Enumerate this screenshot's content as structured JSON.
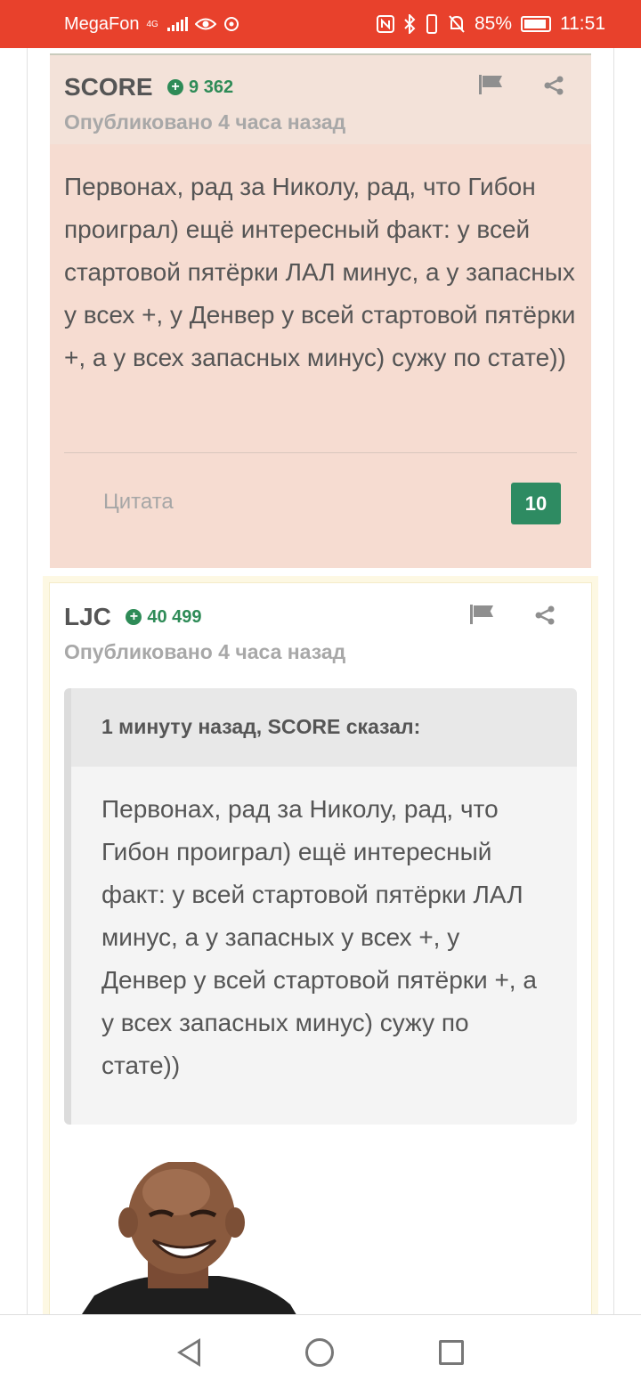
{
  "status_bar": {
    "carrier": "MegaFon",
    "network": "4G",
    "battery": "85%",
    "time": "11:51"
  },
  "posts": [
    {
      "author": "SCORE",
      "reputation": "9 362",
      "published": "Опубликовано 4 часа назад",
      "body": "Первонах, рад за Николу, рад, что Гибон проиграл) ещё интересный факт: у всей стартовой  пятёрки ЛАЛ минус, а у запасных у всех +, у Денвер у всей стартовой пятёрки +, а у всех запасных минус) сужу по стате))",
      "quote_button": "Цитата",
      "likes": "10",
      "background": "#f6dcd1"
    },
    {
      "author": "LJC",
      "reputation": "40 499",
      "published": "Опубликовано 4 часа назад",
      "quote": {
        "citation": "1 минуту назад, SCORE сказал:",
        "body": "Первонах, рад за Николу, рад, что Гибон проиграл) ещё интересный факт: у всей стартовой  пятёрки ЛАЛ минус, а у запасных у всех +, у Денвер у всей стартовой пятёрки +, а у всех запасных минус) сужу по стате))"
      }
    }
  ],
  "colors": {
    "status_bar": "#e8412c",
    "reputation": "#2e8b57",
    "likes_badge": "#2e8b62"
  },
  "icons": [
    "flag-icon",
    "share-icon",
    "nav-back-icon",
    "nav-home-icon",
    "nav-recent-icon"
  ]
}
